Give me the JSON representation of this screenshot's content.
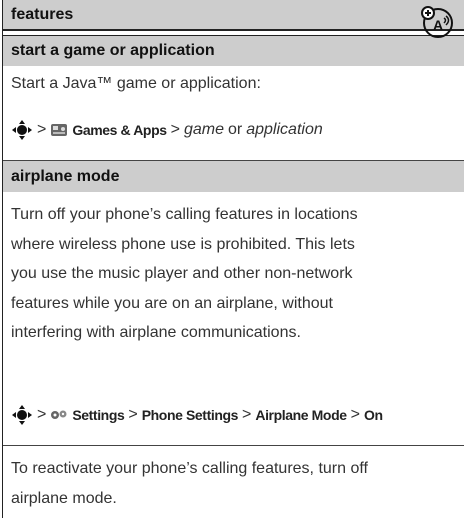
{
  "header": {
    "title": "features"
  },
  "sections": [
    {
      "title": "start a game or application",
      "icon": "speakerphone-icon",
      "intro": "Start a Java™ game or application:",
      "path": {
        "sep": ">",
        "menu_label": "Games & Apps",
        "target_a": "game",
        "or": "or",
        "target_b": "application"
      }
    },
    {
      "title": "airplane mode",
      "body": [
        "Turn off your phone’s calling features in locations",
        "where wireless phone use is prohibited. This lets",
        "you use the music player and other non-network",
        "features while you are on an airplane, without",
        "interfering with airplane communications."
      ],
      "path": {
        "sep": ">",
        "items": [
          "Settings",
          "Phone Settings",
          "Airplane Mode",
          "On"
        ]
      },
      "footer": [
        "To reactivate your phone’s calling features, turn off",
        "airplane mode."
      ]
    }
  ]
}
